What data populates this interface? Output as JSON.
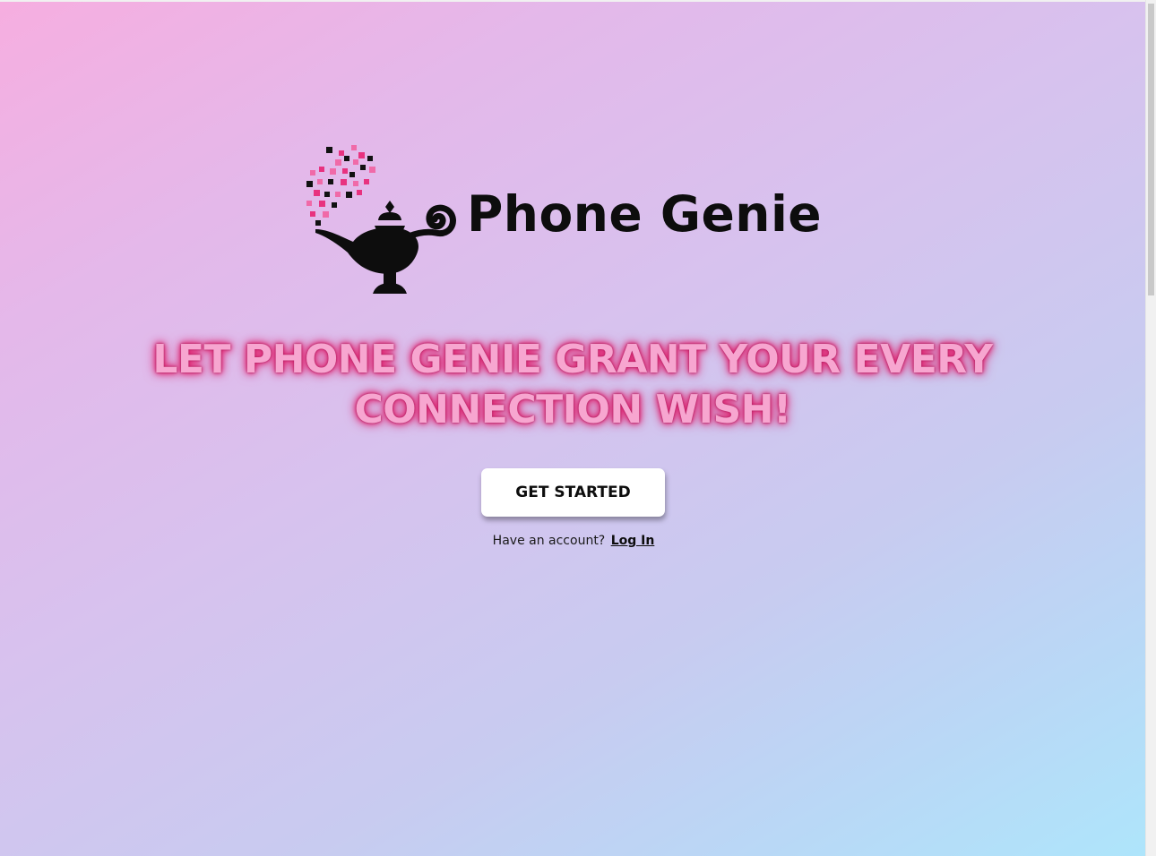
{
  "brand": {
    "name": "Phone Genie",
    "logo_icon": "genie-lamp-icon",
    "sparkle_colors": [
      "#111111",
      "#e8327f",
      "#f06aa8"
    ]
  },
  "hero": {
    "headline": "LET PHONE GENIE GRANT YOUR EVERY CONNECTION WISH!",
    "headline_color": "#f7a6d0",
    "glow_color": "#e0226f"
  },
  "cta": {
    "label": "GET STARTED"
  },
  "account": {
    "prompt": "Have an account?",
    "login_label": "Log In"
  },
  "theme": {
    "gradient_start": "#f6aee0",
    "gradient_end": "#aee5fb"
  }
}
